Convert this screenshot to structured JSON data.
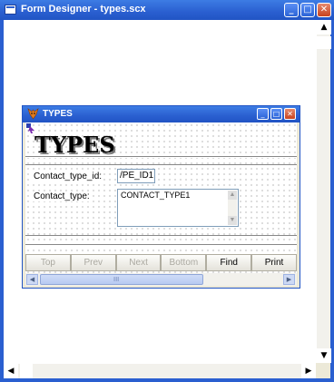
{
  "window": {
    "title": "Form Designer - types.scx",
    "minimize_glyph": "_",
    "maximize_glyph": "□",
    "close_glyph": "✕"
  },
  "scrollbars": {
    "up_glyph": "▲",
    "down_glyph": "▼",
    "left_glyph": "◀",
    "right_glyph": "▶"
  },
  "form": {
    "title": "TYPES",
    "icon": "fox-icon",
    "heading": "TYPES",
    "fields": [
      {
        "label": "Contact_type_id:",
        "value": "/PE_ID1"
      },
      {
        "label": "Contact_type:",
        "value": "CONTACT_TYPE1"
      }
    ],
    "navigation": [
      {
        "label": "Top",
        "enabled": false
      },
      {
        "label": "Prev",
        "enabled": false
      },
      {
        "label": "Next",
        "enabled": false
      },
      {
        "label": "Bottom",
        "enabled": false
      },
      {
        "label": "Find",
        "enabled": true
      },
      {
        "label": "Print",
        "enabled": true
      }
    ],
    "hscroll_thumb_glyph": "III"
  },
  "colors": {
    "titlebar": "#2a5fd0",
    "close_button": "#c8421e",
    "form_background": "#ece9d8"
  }
}
